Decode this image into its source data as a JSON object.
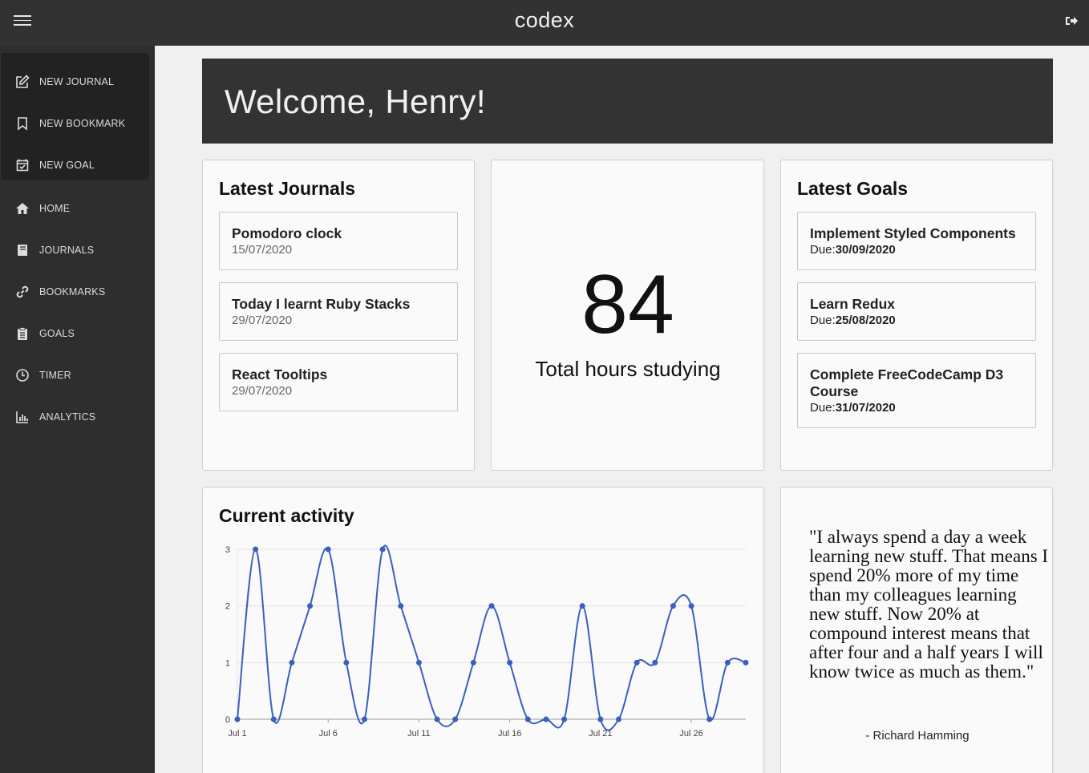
{
  "app": {
    "logo": "codex"
  },
  "sidebar": {
    "actions": [
      {
        "label": "NEW JOURNAL",
        "icon": "edit-icon"
      },
      {
        "label": "NEW BOOKMARK",
        "icon": "bookmark-icon"
      },
      {
        "label": "NEW GOAL",
        "icon": "calendar-check-icon"
      }
    ],
    "nav": [
      {
        "label": "HOME",
        "icon": "home-icon"
      },
      {
        "label": "JOURNALS",
        "icon": "book-icon"
      },
      {
        "label": "BOOKMARKS",
        "icon": "link-icon"
      },
      {
        "label": "GOALS",
        "icon": "clipboard-icon"
      },
      {
        "label": "TIMER",
        "icon": "clock-icon"
      },
      {
        "label": "ANALYTICS",
        "icon": "bar-chart-icon"
      }
    ]
  },
  "welcome": {
    "text": "Welcome, Henry!"
  },
  "journals": {
    "title": "Latest Journals",
    "items": [
      {
        "title": "Pomodoro clock",
        "date": "15/07/2020"
      },
      {
        "title": "Today I learnt Ruby Stacks",
        "date": "29/07/2020"
      },
      {
        "title": "React Tooltips",
        "date": "29/07/2020"
      }
    ]
  },
  "stats": {
    "hours": "84",
    "label": "Total hours studying"
  },
  "goals": {
    "title": "Latest Goals",
    "due_prefix": "Due:",
    "items": [
      {
        "title": "Implement Styled Components",
        "due": "30/09/2020"
      },
      {
        "title": "Learn Redux",
        "due": "25/08/2020"
      },
      {
        "title": "Complete FreeCodeCamp D3 Course",
        "due": "31/07/2020"
      }
    ]
  },
  "activity": {
    "title": "Current activity"
  },
  "quote": {
    "text": "\"I always spend a day a week learning new stuff. That means I spend 20% more of my time than my colleagues learning new stuff. Now 20% at compound interest means that after four and a half years I will know twice as much as them.\"",
    "author": "- Richard Hamming"
  },
  "chart_data": {
    "type": "line",
    "x_tick_labels": [
      "Jul 1",
      "Jul 6",
      "Jul 11",
      "Jul 16",
      "Jul 21",
      "Jul 26"
    ],
    "x_day_start": 1,
    "y_ticks": [
      0,
      1,
      2,
      3
    ],
    "ylim": [
      0,
      3
    ],
    "grid": true,
    "color": "#3b5fc0",
    "values": [
      0,
      3,
      0,
      1,
      2,
      3,
      1,
      0,
      3,
      2,
      1,
      0,
      0,
      1,
      2,
      1,
      0,
      0,
      0,
      2,
      0,
      0,
      1,
      1,
      2,
      2,
      0,
      1,
      1
    ]
  }
}
